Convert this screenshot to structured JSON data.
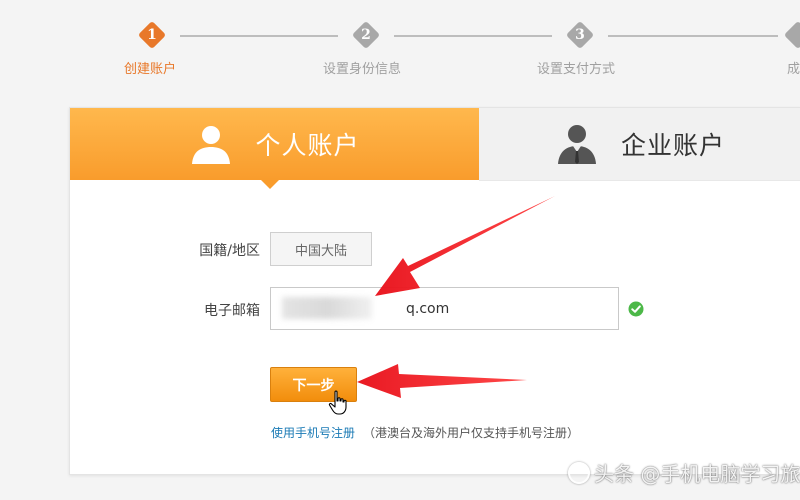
{
  "steps": [
    {
      "number": "1",
      "label": "创建账户",
      "active": true
    },
    {
      "number": "2",
      "label": "设置身份信息",
      "active": false
    },
    {
      "number": "3",
      "label": "设置支付方式",
      "active": false
    },
    {
      "number": "",
      "label": "成",
      "active": false
    }
  ],
  "tabs": {
    "personal": {
      "label": "个人账户",
      "icon": "person-icon"
    },
    "business": {
      "label": "企业账户",
      "icon": "business-person-icon"
    }
  },
  "form": {
    "region_label": "国籍/地区",
    "region_value": "中国大陆",
    "email_label": "电子邮箱",
    "email_value": "q.com",
    "email_status_icon": "check-circle-icon",
    "next_label": "下一步",
    "phone_link": "使用手机号注册",
    "phone_note": "（港澳台及海外用户仅支持手机号注册）"
  },
  "watermark": "头条 @手机电脑学习旅行",
  "colors": {
    "accent": "#f99c2c",
    "step_active": "#e8782a",
    "step_inactive": "#a8a8a8",
    "link": "#1a7ab5",
    "check": "#4cb848",
    "arrow": "#e8101a"
  }
}
